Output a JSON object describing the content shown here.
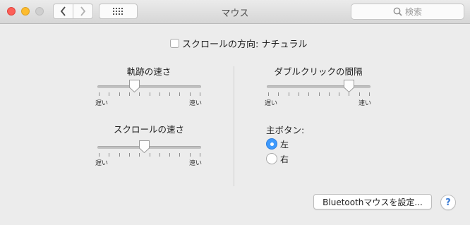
{
  "window": {
    "title": "マウス"
  },
  "search": {
    "placeholder": "検索"
  },
  "natural_scroll": {
    "label": "スクロールの方向: ナチュラル",
    "checked": false
  },
  "tracking_speed": {
    "label": "軌跡の速さ",
    "min_label": "遅い",
    "max_label": "速い",
    "value": 0.35
  },
  "scrolling_speed": {
    "label": "スクロールの速さ",
    "min_label": "遅い",
    "max_label": "速い",
    "value": 0.45
  },
  "double_click_speed": {
    "label": "ダブルクリックの間隔",
    "min_label": "遅い",
    "max_label": "速い",
    "value": 0.8
  },
  "primary_button": {
    "label": "主ボタン:",
    "options": [
      {
        "label": "左",
        "selected": true
      },
      {
        "label": "右",
        "selected": false
      }
    ]
  },
  "bluetooth_button": {
    "label": "Bluetoothマウスを設定..."
  },
  "help_button": {
    "label": "?"
  },
  "colors": {
    "accent": "#3f9afc",
    "close": "#fc5f57",
    "minimize": "#fdbc2e"
  },
  "icons": [
    "close-icon",
    "minimize-icon",
    "zoom-icon",
    "chevron-left-icon",
    "chevron-right-icon",
    "grid-icon",
    "search-icon"
  ]
}
